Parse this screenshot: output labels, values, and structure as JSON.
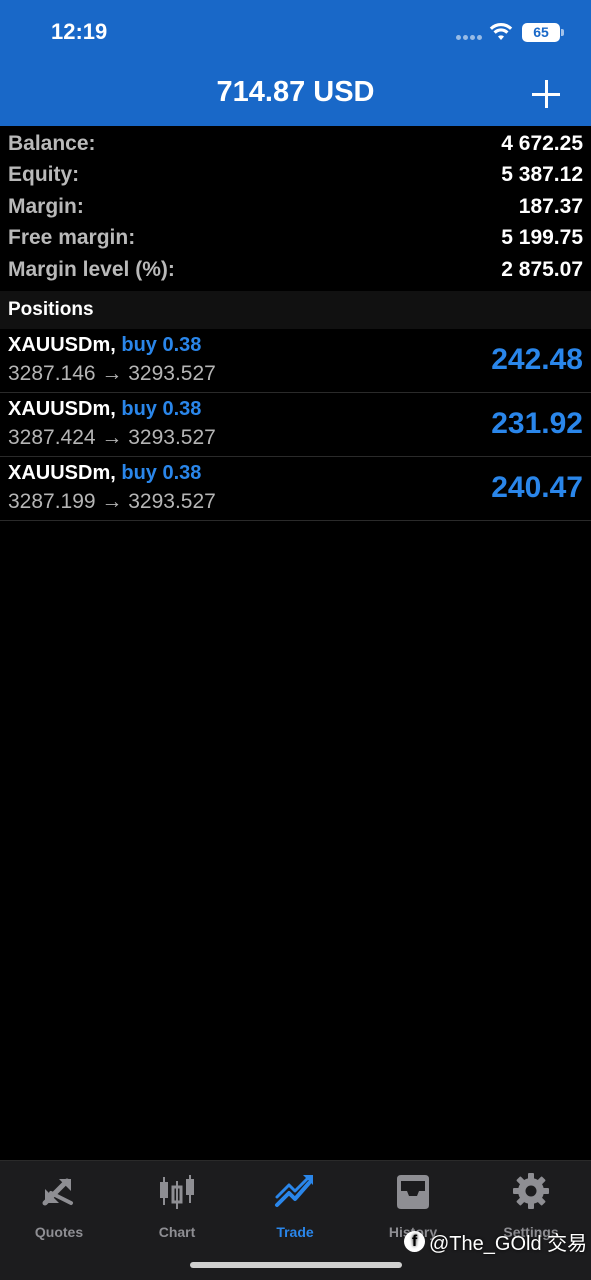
{
  "status_bar": {
    "time": "12:19",
    "battery": "65"
  },
  "header": {
    "title": "714.87 USD"
  },
  "summary": [
    {
      "label": "Balance:",
      "value": "4 672.25"
    },
    {
      "label": "Equity:",
      "value": "5 387.12"
    },
    {
      "label": "Margin:",
      "value": "187.37"
    },
    {
      "label": "Free margin:",
      "value": "5 199.75"
    },
    {
      "label": "Margin level (%):",
      "value": "2 875.07"
    }
  ],
  "positions_title": "Positions",
  "positions": [
    {
      "symbol": "XAUUSDm,",
      "type": "buy 0.38",
      "prices": "3287.146 → 3293.527",
      "profit": "242.48"
    },
    {
      "symbol": "XAUUSDm,",
      "type": "buy 0.38",
      "prices": "3287.424 → 3293.527",
      "profit": "231.92"
    },
    {
      "symbol": "XAUUSDm,",
      "type": "buy 0.38",
      "prices": "3287.199 → 3293.527",
      "profit": "240.47"
    }
  ],
  "tabs": [
    {
      "label": "Quotes",
      "icon": "quotes-icon",
      "active": false
    },
    {
      "label": "Chart",
      "icon": "chart-icon",
      "active": false
    },
    {
      "label": "Trade",
      "icon": "trade-icon",
      "active": true
    },
    {
      "label": "History",
      "icon": "history-icon",
      "active": false
    },
    {
      "label": "Settings",
      "icon": "settings-icon",
      "active": false
    }
  ],
  "watermark": "@The_GOld 交易",
  "colors": {
    "header": "#1968c8",
    "accent": "#2a86ea",
    "background": "#000000"
  }
}
